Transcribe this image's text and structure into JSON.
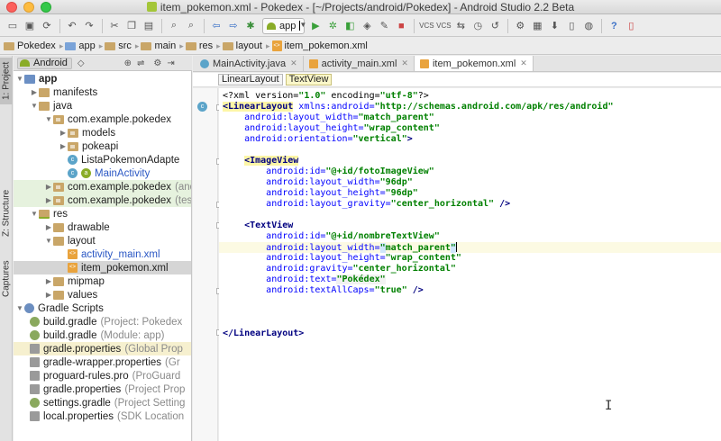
{
  "window": {
    "title": "item_pokemon.xml - Pokedex - [~/Projects/android/Pokedex] - Android Studio 2.2 Beta"
  },
  "toolbar": {
    "run_config": "app"
  },
  "navbar": {
    "crumbs": [
      "Pokedex",
      "app",
      "src",
      "main",
      "res",
      "layout",
      "item_pokemon.xml"
    ]
  },
  "left_stripe": {
    "project_tab": "1: Project",
    "structure_tab": "Z: Structure",
    "captures_tab": "Captures"
  },
  "project_panel": {
    "view_mode": "Android"
  },
  "tree": [
    {
      "label": "app",
      "sub": ""
    },
    {
      "label": "manifests",
      "sub": ""
    },
    {
      "label": "java",
      "sub": ""
    },
    {
      "label": "com.example.pokedex",
      "sub": ""
    },
    {
      "label": "models",
      "sub": ""
    },
    {
      "label": "pokeapi",
      "sub": ""
    },
    {
      "label": "ListaPokemonAdapte",
      "sub": ""
    },
    {
      "label": "MainActivity",
      "sub": ""
    },
    {
      "label": "com.example.pokedex",
      "sub": "(and"
    },
    {
      "label": "com.example.pokedex",
      "sub": "(tes"
    },
    {
      "label": "res",
      "sub": ""
    },
    {
      "label": "drawable",
      "sub": ""
    },
    {
      "label": "layout",
      "sub": ""
    },
    {
      "label": "activity_main.xml",
      "sub": ""
    },
    {
      "label": "item_pokemon.xml",
      "sub": ""
    },
    {
      "label": "mipmap",
      "sub": ""
    },
    {
      "label": "values",
      "sub": ""
    },
    {
      "label": "Gradle Scripts",
      "sub": ""
    },
    {
      "label": "build.gradle",
      "sub": "(Project: Pokedex"
    },
    {
      "label": "build.gradle",
      "sub": "(Module: app)"
    },
    {
      "label": "gradle.properties",
      "sub": "(Global Prop"
    },
    {
      "label": "gradle-wrapper.properties",
      "sub": "(Gr"
    },
    {
      "label": "proguard-rules.pro",
      "sub": "(ProGuard"
    },
    {
      "label": "gradle.properties",
      "sub": "(Project Prop"
    },
    {
      "label": "settings.gradle",
      "sub": "(Project Setting"
    },
    {
      "label": "local.properties",
      "sub": "(SDK Location"
    }
  ],
  "editor": {
    "tabs": [
      {
        "label": "MainActivity.java"
      },
      {
        "label": "activity_main.xml"
      },
      {
        "label": "item_pokemon.xml"
      }
    ],
    "crumbs": [
      "LinearLayout",
      "TextView"
    ]
  },
  "code": {
    "l1_a": "<?xml version=",
    "l1_b": "\"1.0\"",
    "l1_c": " encoding=",
    "l1_d": "\"utf-8\"",
    "l1_e": "?>",
    "l2_tag": "<LinearLayout",
    "l2_attr": " xmlns:android=",
    "l2_val": "\"http://schemas.android.com/apk/res/android\"",
    "l3_attr": "android:layout_width=",
    "l3_val": "\"match_parent\"",
    "l4_attr": "android:layout_height=",
    "l4_val": "\"wrap_content\"",
    "l5_attr": "android:orientation=",
    "l5_val": "\"vertical\"",
    "l5_end": ">",
    "l7_tag": "<ImageView",
    "l8_attr": "android:id=",
    "l8_val": "\"@+id/fotoImageView\"",
    "l9_attr": "android:layout_width=",
    "l9_val": "\"96dp\"",
    "l10_attr": "android:layout_height=",
    "l10_val": "\"96dp\"",
    "l11_attr": "android:layout_gravity=",
    "l11_val": "\"center_horizontal\"",
    "l11_end": " />",
    "l13_tag": "<TextView",
    "l14_attr": "android:id=",
    "l14_val": "\"@+id/nombreTextView\"",
    "l15_attr": "android:layout_width=",
    "l15_q1": "\"",
    "l15_val": "match_parent",
    "l15_q2": "\"",
    "l16_attr": "android:layout_height=",
    "l16_val": "\"wrap_content\"",
    "l17_attr": "android:gravity=",
    "l17_val": "\"center_horizontal\"",
    "l18_attr": "android:text=",
    "l18_val": "\"Pokédex\"",
    "l19_attr": "android:textAllCaps=",
    "l19_val": "\"true\"",
    "l19_end": " />",
    "l22_tag": "</LinearLayout>"
  },
  "colors": {
    "xml_tag": "#000080",
    "xml_attr": "#0000ff",
    "xml_value": "#008000",
    "current_line": "#fcfae3",
    "android_green": "#a4c639"
  }
}
